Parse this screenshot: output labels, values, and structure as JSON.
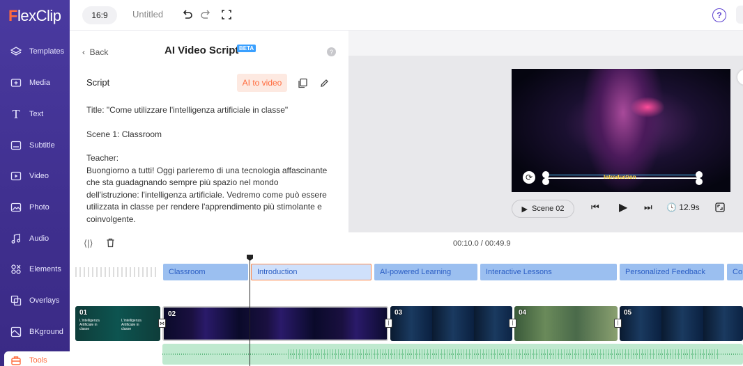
{
  "app": {
    "logo_f": "F",
    "logo_rest": "lexClip"
  },
  "sidebar": {
    "items": [
      {
        "label": "Templates",
        "icon": "layers-icon"
      },
      {
        "label": "Media",
        "icon": "media-add-icon"
      },
      {
        "label": "Text",
        "icon": "text-icon"
      },
      {
        "label": "Subtitle",
        "icon": "subtitle-icon"
      },
      {
        "label": "Video",
        "icon": "video-icon"
      },
      {
        "label": "Photo",
        "icon": "photo-icon"
      },
      {
        "label": "Audio",
        "icon": "audio-icon"
      },
      {
        "label": "Elements",
        "icon": "elements-icon"
      },
      {
        "label": "Overlays",
        "icon": "overlays-icon"
      },
      {
        "label": "BKground",
        "icon": "background-icon"
      },
      {
        "label": "Tools",
        "icon": "tools-icon"
      }
    ]
  },
  "topbar": {
    "ratio": "16:9",
    "title": "Untitled",
    "help": "?"
  },
  "panel": {
    "back": "Back",
    "title": "AI Video Script",
    "beta": "BETA",
    "script_label": "Script",
    "ai_to_video": "AI to video",
    "paragraphs": [
      "Title: \"Come utilizzare l'intelligenza artificiale in classe\"",
      "Scene 1: Classroom",
      "Teacher:",
      "Buongiorno a tutti! Oggi parleremo di una tecnologia affascinante che sta guadagnando sempre più spazio nel mondo dell'istruzione: l'intelligenza artificiale. Vedremo come può essere utilizzata in classe per rendere l'apprendimento più stimolante e coinvolgente."
    ]
  },
  "preview": {
    "caption": "Introduction",
    "scene_button": "Scene 02",
    "duration": "12.9s"
  },
  "timeline": {
    "timecode": "00:10.0 / 00:49.9",
    "scenes": [
      "Classroom",
      "Introduction",
      "AI-powered Learning",
      "Interactive Lessons",
      "Personalized Feedback",
      "Co"
    ],
    "clips": [
      "01",
      "02",
      "03",
      "04",
      "05"
    ],
    "clip1_text": "L'intelligenza Artificiale in classe"
  },
  "colors": {
    "accent": "#ff6b3d",
    "sidebar": "#4a3aa0",
    "scene_chip": "#9bbff0",
    "audio": "#bfe9cf"
  }
}
